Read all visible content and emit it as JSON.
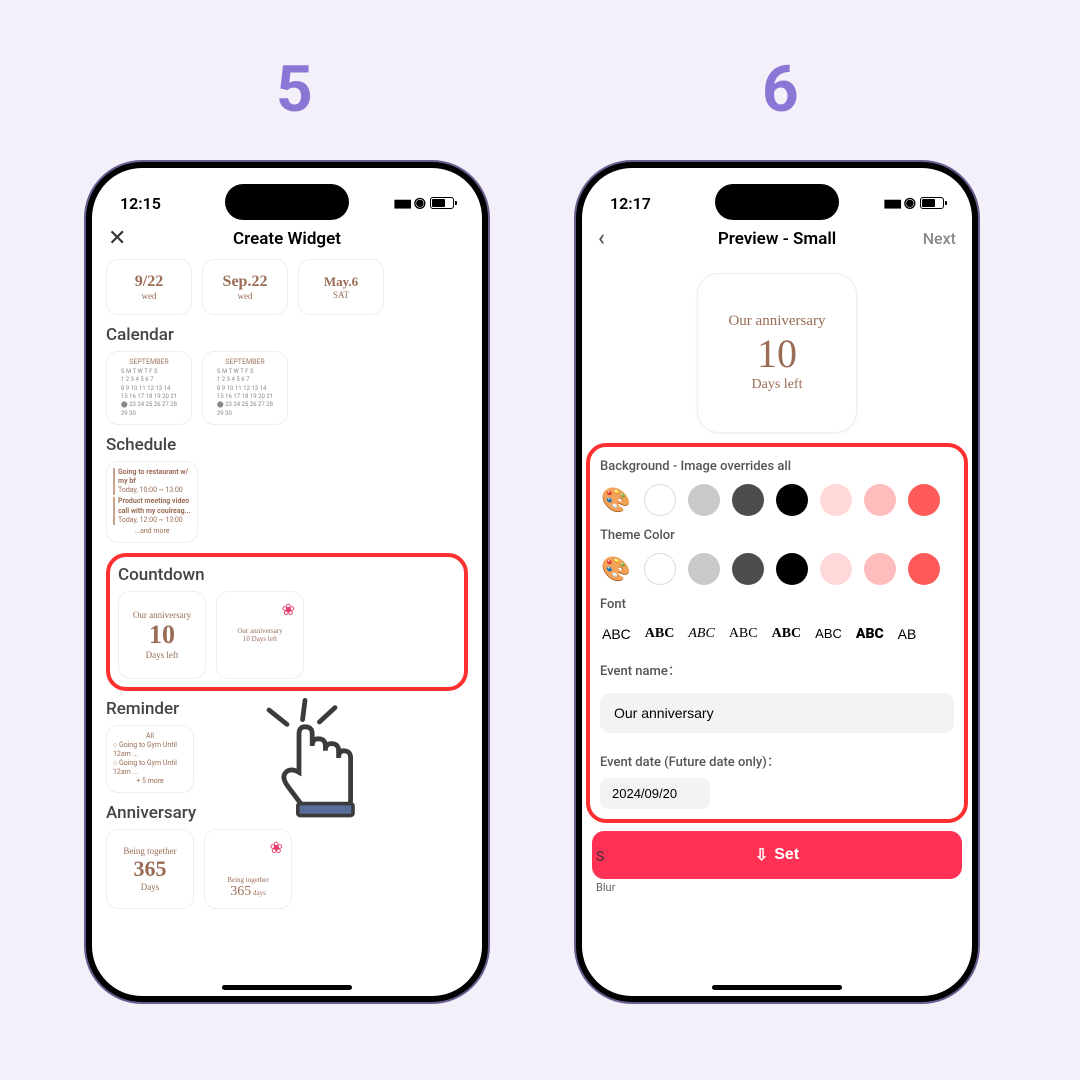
{
  "steps": {
    "five": "5",
    "six": "6"
  },
  "left": {
    "time": "12:15",
    "title": "Create Widget",
    "dateCards": [
      {
        "big": "9/22",
        "sm": "wed"
      },
      {
        "big": "Sep.22",
        "sm": "wed"
      },
      {
        "big": "May.6",
        "sm": "SAT"
      }
    ],
    "sections": {
      "calendar": "Calendar",
      "schedule": "Schedule",
      "countdown": "Countdown",
      "reminder": "Reminder",
      "anniversary": "Anniversary"
    },
    "calMonth": "SEPTEMBER",
    "sched": {
      "i1": "Going to restaurant w/ my bf",
      "i1b": "Today, 10:00 ~ 13:00",
      "i2": "Product meeting video call with my coulreag...",
      "i2b": "Today, 12:00 ~ 13:00",
      "more": "...and more"
    },
    "countdown": {
      "title": "Our anniversary",
      "num": "10",
      "sub": "Days left"
    },
    "reminderCard": {
      "head": "All",
      "i1": "Going to Gym Until 12am ...",
      "i2": "Going to Gym Until 12am ...",
      "more": "+ 5 more"
    },
    "anniv": {
      "title": "Being together",
      "num": "365",
      "sub": "Days",
      "alt": "Being together",
      "altnum": "365",
      "altsub": "days"
    }
  },
  "right": {
    "time": "12:17",
    "title": "Preview - Small",
    "next": "Next",
    "preview": {
      "title": "Our anniversary",
      "num": "10",
      "sub": "Days left"
    },
    "labels": {
      "bg": "Background - Image overrides all",
      "theme": "Theme Color",
      "font": "Font",
      "eventName": "Event name：",
      "eventDate": "Event date (Future date only)："
    },
    "fonts": [
      "ABC",
      "ABC",
      "ABC",
      "ABC",
      "ABC",
      "ABC",
      "ABC",
      "AB"
    ],
    "eventNameValue": "Our anniversary",
    "eventDateValue": "2024/09/20",
    "setLabel": "Set",
    "blur": "Blur",
    "s": "S"
  }
}
